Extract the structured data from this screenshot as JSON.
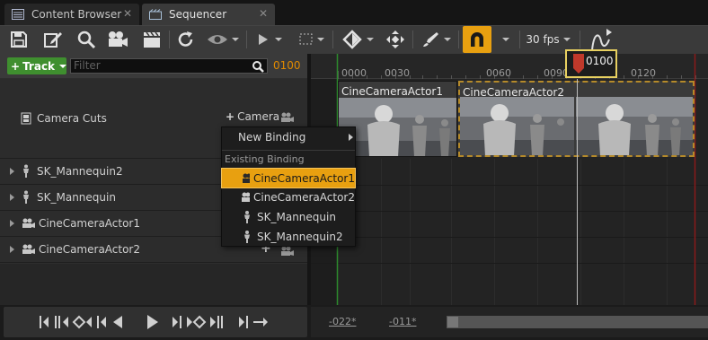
{
  "tabs": [
    {
      "label": "Content Browser",
      "icon": "content-browser-icon",
      "active": false
    },
    {
      "label": "Sequencer",
      "icon": "sequencer-icon",
      "active": true
    }
  ],
  "toolbar": {
    "fps_label": "30 fps",
    "icons": [
      "save-icon",
      "edit-icon",
      "search-icon",
      "camera-icon",
      "clapperboard-icon",
      "refresh-icon",
      "eye-icon",
      "play-icon",
      "selection-icon",
      "key-icon",
      "transform-icon",
      "brush-icon",
      "snap-magnet-icon",
      "curve-editor-icon"
    ]
  },
  "track_header": {
    "add_track_label": "Track",
    "filter_placeholder": "Filter",
    "current_frame": "0100"
  },
  "tracks": [
    {
      "label": "Camera Cuts",
      "add_label": "Camera",
      "icon": "camera-cuts-icon"
    },
    {
      "label": "SK_Mannequin2",
      "icon": "mannequin-icon"
    },
    {
      "label": "SK_Mannequin",
      "icon": "mannequin-icon"
    },
    {
      "label": "CineCameraActor1",
      "icon": "cine-camera-icon"
    },
    {
      "label": "CineCameraActor2",
      "icon": "cine-camera-icon"
    }
  ],
  "timeline": {
    "ticks": [
      "0000",
      "0030",
      "0060",
      "0090",
      "0120"
    ],
    "playhead_label": "0100",
    "sections": [
      {
        "label": "CineCameraActor1"
      },
      {
        "label": "CineCameraActor2"
      }
    ]
  },
  "menu": {
    "new_binding": "New Binding",
    "existing_header": "Existing Binding",
    "items": [
      {
        "label": "CineCameraActor1",
        "icon": "cine-camera-icon",
        "selected": true
      },
      {
        "label": "CineCameraActor2",
        "icon": "cine-camera-icon",
        "selected": false
      },
      {
        "label": "SK_Mannequin",
        "icon": "mannequin-icon",
        "selected": false
      },
      {
        "label": "SK_Mannequin2",
        "icon": "mannequin-icon",
        "selected": false
      }
    ]
  },
  "bottom": {
    "range_start": "-022*",
    "range_end": "-011*",
    "transport_icons": [
      "jump-to-start-icon",
      "previous-key-icon",
      "previous-frame-icon",
      "play-reverse-icon",
      "play-icon",
      "next-frame-icon",
      "next-key-icon",
      "jump-to-end-icon",
      "loop-icon"
    ]
  },
  "colors": {
    "accent": "#e8a010",
    "add_track_green": "#3f8f2f",
    "frame_orange": "#e08a00",
    "playhead_red": "#c0392b"
  }
}
